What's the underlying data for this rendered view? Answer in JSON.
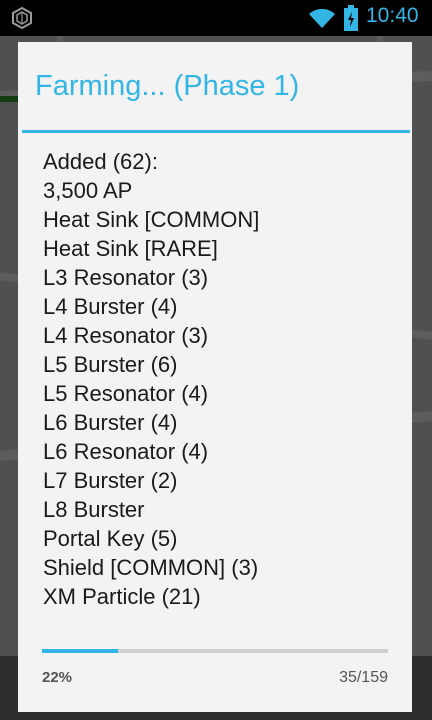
{
  "status_bar": {
    "time": "10:40",
    "icons": [
      "app-hexagon-icon",
      "wifi-icon",
      "battery-charging-icon"
    ],
    "accent_color": "#33b5e5"
  },
  "dialog": {
    "title": "Farming... (Phase 1)",
    "accent_color": "#33b5e5",
    "items": [
      "Added (62):",
      "3,500 AP",
      "Heat Sink [COMMON]",
      "Heat Sink [RARE]",
      "L3 Resonator (3)",
      "L4 Burster (4)",
      "L4 Resonator (3)",
      "L5 Burster (6)",
      "L5 Resonator (4)",
      "L6 Burster (4)",
      "L6 Resonator (4)",
      "L7 Burster (2)",
      "L8 Burster",
      "Portal Key (5)",
      "Shield [COMMON] (3)",
      "XM Particle (21)"
    ],
    "progress": {
      "percent_label": "22%",
      "count_label": "35/159",
      "fraction": 0.22
    }
  }
}
